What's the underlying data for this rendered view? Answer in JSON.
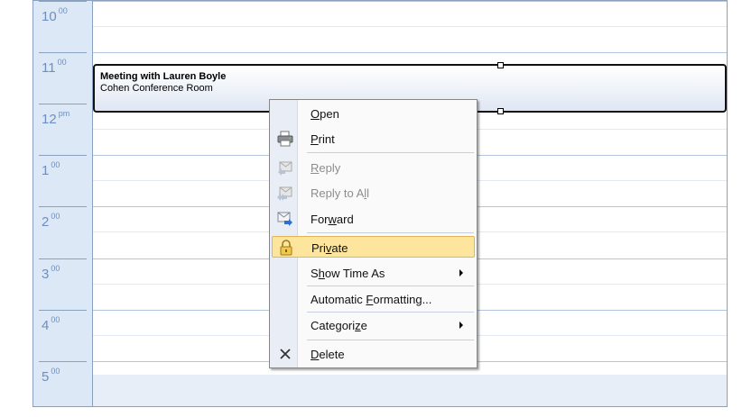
{
  "calendar": {
    "hours": [
      {
        "hour": "10",
        "sup": "00"
      },
      {
        "hour": "11",
        "sup": "00"
      },
      {
        "hour": "12",
        "sup": "pm"
      },
      {
        "hour": "1",
        "sup": "00"
      },
      {
        "hour": "2",
        "sup": "00"
      },
      {
        "hour": "3",
        "sup": "00"
      },
      {
        "hour": "4",
        "sup": "00"
      },
      {
        "hour": "5",
        "sup": "00"
      }
    ]
  },
  "appointment": {
    "title": "Meeting with Lauren Boyle",
    "location": "Cohen Conference Room"
  },
  "context_menu": {
    "items": [
      {
        "label": "Open",
        "accel_index": 0,
        "icon": "",
        "enabled": true
      },
      {
        "label": "Print",
        "accel_index": 0,
        "icon": "print-icon",
        "enabled": true
      },
      {
        "label": "Reply",
        "accel_index": 0,
        "icon": "reply-icon",
        "enabled": false
      },
      {
        "label": "Reply to All",
        "accel_index": 10,
        "icon": "reply-all-icon",
        "enabled": false
      },
      {
        "label": "Forward",
        "accel_index": 3,
        "icon": "forward-icon",
        "enabled": true
      },
      {
        "label": "Private",
        "accel_index": 3,
        "icon": "lock-icon",
        "enabled": true,
        "highlighted": true
      },
      {
        "label": "Show Time As",
        "accel_index": 1,
        "icon": "",
        "enabled": true,
        "submenu": true
      },
      {
        "label": "Automatic Formatting...",
        "accel_index": 10,
        "icon": "",
        "enabled": true
      },
      {
        "label": "Categorize",
        "accel_index": 8,
        "icon": "",
        "enabled": true,
        "submenu": true
      },
      {
        "label": "Delete",
        "accel_index": 0,
        "icon": "delete-icon",
        "enabled": true
      }
    ]
  },
  "colors": {
    "ruler_bg": "#dde8f7",
    "highlight": "#fde59e",
    "hour_text": "#6d8fbf"
  }
}
